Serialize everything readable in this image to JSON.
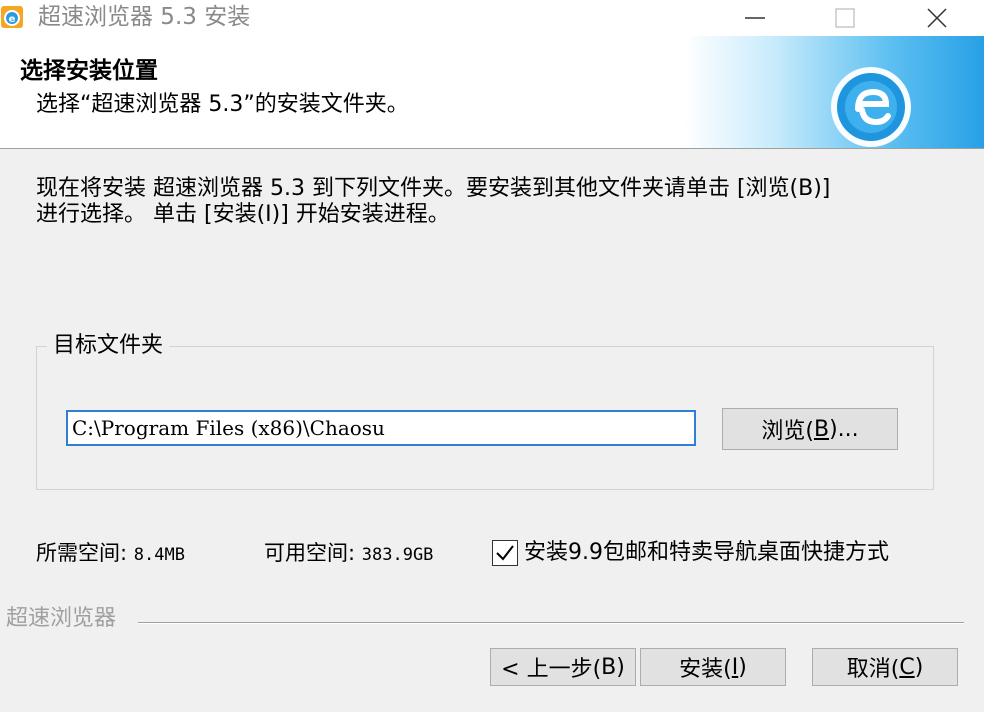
{
  "window": {
    "title": "超速浏览器 5.3 安装"
  },
  "header": {
    "title": "选择安装位置",
    "subtitle": "选择“超速浏览器 5.3”的安装文件夹。"
  },
  "intro": {
    "line1": "现在将安装 超速浏览器 5.3 到下列文件夹。要安装到其他文件夹请单击 [浏览(B)]",
    "line2": "进行选择。 单击 [安装(I)] 开始安装进程。"
  },
  "destination": {
    "legend": "目标文件夹",
    "path": "C:\\Program Files (x86)\\Chaosu",
    "browse_label_pre": "浏览(",
    "browse_label_key": "B",
    "browse_label_post": ")..."
  },
  "space": {
    "required_label": "所需空间:",
    "required_value": "8.4MB",
    "available_label": "可用空间:",
    "available_value": "383.9GB"
  },
  "shortcut_option": {
    "label": "安装9.9包邮和特卖导航桌面快捷方式",
    "checked": true
  },
  "branding": {
    "text": "超速浏览器"
  },
  "buttons": {
    "back_pre": "< 上一步(",
    "back_key": "B",
    "back_post": ")",
    "install_pre": "安装(",
    "install_key": "I",
    "install_post": ")",
    "cancel_pre": "取消(",
    "cancel_key": "C",
    "cancel_post": ")"
  },
  "colors": {
    "accent": "#2f7fd6",
    "banner_blue": "#28a0e6"
  },
  "icons": {
    "app": "browser-logo-icon",
    "minimize": "minimize-icon",
    "maximize": "maximize-icon",
    "close": "close-icon",
    "header_logo": "browser-e-logo-icon",
    "checkbox": "checkmark-icon"
  }
}
